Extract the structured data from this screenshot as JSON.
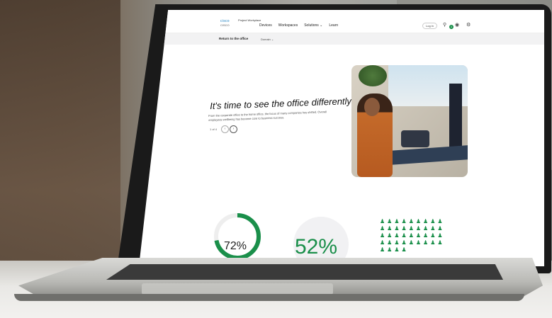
{
  "nav": {
    "logo_text": "cisco",
    "logo_sub": "CISCO",
    "brand": "Project Workplace",
    "links": [
      "Devices",
      "Workspaces",
      "Solutions ⌄",
      "Learn"
    ],
    "login": "Log in",
    "notification_count": "1"
  },
  "subnav": {
    "title": "Return to the office",
    "dropdown": "Domain ⌄"
  },
  "hero": {
    "title": "It's time to see the office differently",
    "text": "From the corporate office to the home office, the focus of many companies has shifted. Overall employees wellbeing has become core to business success.",
    "pager": "1 of 4",
    "prev": "‹",
    "next": "›"
  },
  "stats": {
    "stat1": "72%",
    "stat1_value": 72,
    "stat2": "52%"
  },
  "colors": {
    "accent_green": "#1a8f4a",
    "screen_bg": "#ffffff"
  }
}
